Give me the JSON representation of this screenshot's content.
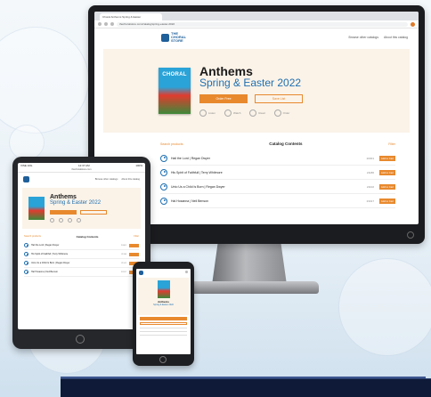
{
  "browser": {
    "tab_title": "Choral Anthems Spring & Easter",
    "url": "thechoralstore.com/catalog/spring-easter-2022"
  },
  "site": {
    "logo_text": "THE CHORAL STORE",
    "nav": [
      "Browse other catalogs",
      "About this catalog"
    ]
  },
  "catalog": {
    "cover_title": "CHORAL",
    "title": "Anthems",
    "subtitle": "Spring & Easter 2022",
    "primary_button": "Order Free",
    "secondary_button": "Save List",
    "formats": [
      "Listen",
      "Watch",
      "Read",
      "Order"
    ]
  },
  "contents": {
    "search_label": "Search products",
    "title": "Catalog Contents",
    "filter_label": "Filter",
    "rows": [
      {
        "title": "Hail the Lord  |  Regan Dwyer",
        "code": "20301",
        "action": "Add to Cart"
      },
      {
        "title": "His Spirit of Faithfull  |  Terry Whitmore",
        "code": "21186",
        "action": "Add to Cart"
      },
      {
        "title": "Unto Us a Child Is Born  |  Regan Dwyer",
        "code": "21102",
        "action": "Add to Cart"
      },
      {
        "title": "Hal Hosanna  |  Neil Benson",
        "code": "23317",
        "action": "Add to Cart"
      }
    ]
  },
  "tablet": {
    "status_left": "VISE 10G",
    "status_time": "12:37 AM",
    "status_right": "100%",
    "url": "thechoralstore.com"
  }
}
